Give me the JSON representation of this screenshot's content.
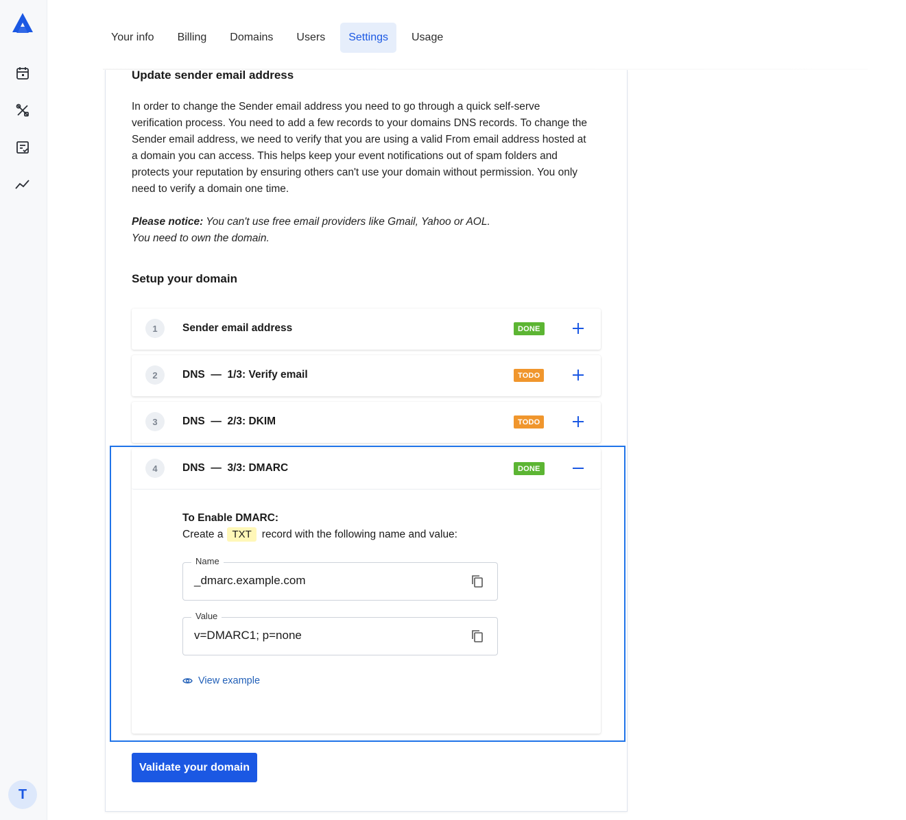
{
  "tabs": [
    {
      "label": "Your info",
      "active": false
    },
    {
      "label": "Billing",
      "active": false
    },
    {
      "label": "Domains",
      "active": false
    },
    {
      "label": "Users",
      "active": false
    },
    {
      "label": "Settings",
      "active": true
    },
    {
      "label": "Usage",
      "active": false
    }
  ],
  "sidebar": {
    "icons": [
      "calendar-icon",
      "tools-icon",
      "checklist-icon",
      "analytics-icon"
    ],
    "avatar_initial": "T"
  },
  "section": {
    "title": "Update sender email address",
    "description": "In order to change the Sender email address you need to go through a quick self-serve verification process. You need to add a few records to your domains DNS records. To change the Sender email address, we need to verify that you are using a valid From email address hosted at a domain you can access. This helps keep your event notifications out of spam folders and protects your reputation by ensuring others can't use your domain without permission. You only need to verify a domain one time.",
    "notice_label": "Please notice:",
    "notice_text": " You can't use free email providers like Gmail, Yahoo or AOL.",
    "notice_text2": "You need to own the domain."
  },
  "setup": {
    "title": "Setup your domain",
    "steps": [
      {
        "number": "1",
        "title": "Sender email address",
        "status": "DONE",
        "expanded": false
      },
      {
        "number": "2",
        "title": "DNS  —  1/3: Verify email",
        "status": "TODO",
        "expanded": false
      },
      {
        "number": "3",
        "title": "DNS  —  2/3: DKIM",
        "status": "TODO",
        "expanded": false
      },
      {
        "number": "4",
        "title": "DNS  —  3/3: DMARC",
        "status": "DONE",
        "expanded": true
      }
    ]
  },
  "dmarc": {
    "heading": "To Enable DMARC:",
    "line_prefix": "Create a",
    "record_type": "TXT",
    "line_suffix": "record with the following name and value:",
    "name_label": "Name",
    "name_value": "_dmarc.example.com",
    "value_label": "Value",
    "value_value": "v=DMARC1; p=none",
    "view_example": "View example"
  },
  "validate_button": "Validate your domain",
  "colors": {
    "primary": "#1b58e3",
    "done": "#5cb533",
    "todo": "#f0962d",
    "highlight": "#1f73e8"
  }
}
